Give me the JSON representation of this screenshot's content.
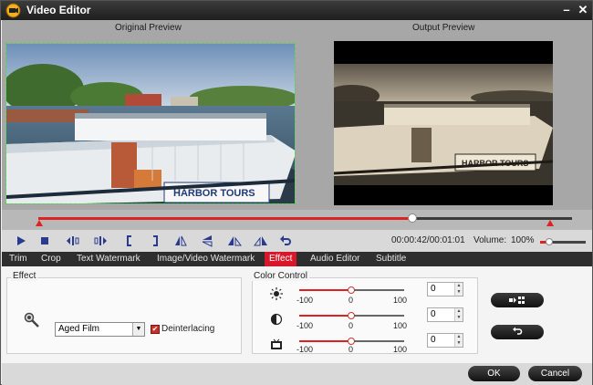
{
  "window": {
    "title": "Video Editor",
    "minimize_label": "–",
    "close_label": "✕"
  },
  "preview": {
    "original_label": "Original Preview",
    "output_label": "Output Preview"
  },
  "timeline": {
    "progress": 0.7
  },
  "controls": {
    "time": "00:00:42/00:01:01",
    "volume_label": "Volume:",
    "volume_value": "100%",
    "volume_level": 1.0
  },
  "tabs": [
    {
      "label": "Trim"
    },
    {
      "label": "Crop"
    },
    {
      "label": "Text Watermark"
    },
    {
      "label": "Image/Video Watermark"
    },
    {
      "label": "Effect",
      "active": true
    },
    {
      "label": "Audio Editor"
    },
    {
      "label": "Subtitle"
    }
  ],
  "effect": {
    "group_title": "Effect",
    "selected_effect": "Aged Film",
    "deinterlacing_label": "Deinterlacing",
    "deinterlacing_checked": true,
    "checkmark": "✔"
  },
  "color_control": {
    "group_title": "Color Control",
    "sliders": [
      {
        "icon": "brightness-icon",
        "min": "-100",
        "mid": "0",
        "max": "100",
        "value": "0"
      },
      {
        "icon": "contrast-icon",
        "min": "-100",
        "mid": "0",
        "max": "100",
        "value": "0"
      },
      {
        "icon": "saturation-icon",
        "min": "-100",
        "mid": "0",
        "max": "100",
        "value": "0"
      }
    ]
  },
  "footer": {
    "ok_label": "OK",
    "cancel_label": "Cancel"
  },
  "colors": {
    "accent": "#d7182a",
    "title_bar": "#2a2a2a",
    "preview_bg": "#a7a7a7"
  }
}
